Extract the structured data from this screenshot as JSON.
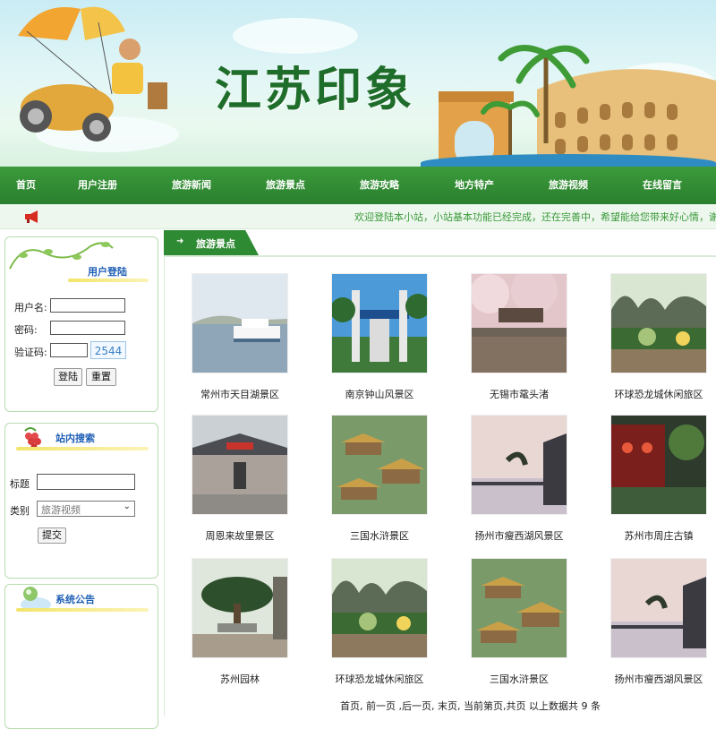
{
  "banner": {
    "title": "江苏印象"
  },
  "nav": {
    "items": [
      {
        "label": "首页"
      },
      {
        "label": "用户注册"
      },
      {
        "label": "旅游新闻"
      },
      {
        "label": "旅游景点"
      },
      {
        "label": "旅游攻略"
      },
      {
        "label": "地方特产"
      },
      {
        "label": "旅游视频"
      },
      {
        "label": "在线留言"
      }
    ]
  },
  "notice": {
    "text": "欢迎登陆本小站，小站基本功能已经完成，还在完善中，希望能给您带来好心情，谢谢支持"
  },
  "login": {
    "title": "用户登陆",
    "username_label": "用户名:",
    "password_label": "密码:",
    "captcha_label": "验证码:",
    "captcha_code": "2544",
    "login_button": "登陆",
    "reset_button": "重置"
  },
  "search": {
    "title": "站内搜索",
    "title_label": "标题",
    "category_label": "类别",
    "category_selected": "旅游视频",
    "submit_button": "提交"
  },
  "announcement": {
    "title": "系统公告"
  },
  "main": {
    "tab_label": "旅游景点",
    "spots": [
      {
        "name": "常州市天目湖景区"
      },
      {
        "name": "南京钟山风景区"
      },
      {
        "name": "无锡市鼋头渚"
      },
      {
        "name": "环球恐龙城休闲旅区"
      },
      {
        "name": "周恩来故里景区"
      },
      {
        "name": "三国水浒景区"
      },
      {
        "name": "扬州市瘦西湖风景区"
      },
      {
        "name": "苏州市周庄古镇"
      },
      {
        "name": "苏州园林"
      },
      {
        "name": "环球恐龙城休闲旅区"
      },
      {
        "name": "三国水浒景区"
      },
      {
        "name": "扬州市瘦西湖风景区"
      }
    ],
    "pager": "首页, 前一页 ,后一页, 末页, 当前第页,共页 以上数据共 9 条"
  },
  "colors": {
    "nav_green": "#2f8a34",
    "accent_blue": "#1f5fb5",
    "notice_green": "#3a9a3a"
  }
}
